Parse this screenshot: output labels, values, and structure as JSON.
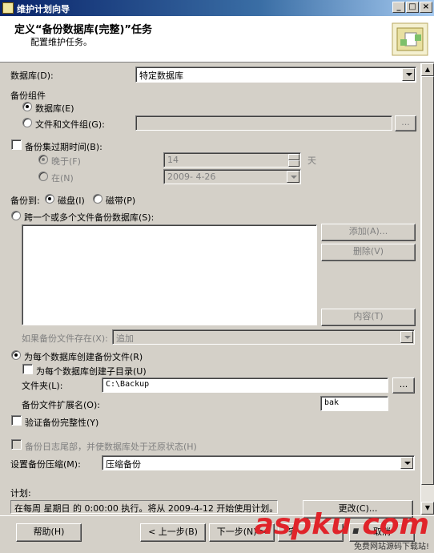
{
  "window": {
    "title": "维护计划向导",
    "controls": [
      "_",
      "□",
      "×"
    ]
  },
  "header": {
    "title": "定义“备份数据库(完整)”任务",
    "subtitle": "配置维护任务。"
  },
  "form": {
    "database_label": "数据库(D):",
    "database_value": "特定数据库",
    "backup_component_label": "备份组件",
    "radio_database": "数据库(E)",
    "radio_files": "文件和文件组(G):",
    "browse_label": "...",
    "expire_check_label": "备份集过期时间(B):",
    "after_label": "晚于(F)",
    "after_value": "14",
    "days_unit": "天",
    "on_label": "在(N)",
    "on_value": "2009- 4-26",
    "backup_to_label": "备份到:",
    "disk_label": "磁盘(I)",
    "tape_label": "磁带(P)",
    "span_files_label": "跨一个或多个文件备份数据库(S):",
    "add_button": "添加(A)...",
    "remove_button": "删除(V)",
    "contents_button": "内容(T)",
    "if_exists_label": "如果备份文件存在(X):",
    "if_exists_value": "追加",
    "per_db_file_label": "为每个数据库创建备份文件(R)",
    "per_db_subdir_label": "为每个数据库创建子目录(U)",
    "folder_label": "文件夹(L):",
    "folder_value": "C:\\Backup",
    "ext_label": "备份文件扩展名(O):",
    "ext_value": "bak",
    "verify_label": "验证备份完整性(Y)",
    "taillog_label": "备份日志尾部，并使数据库处于还原状态(H)",
    "compression_label": "设置备份压缩(M):",
    "compression_value": "压缩备份",
    "schedule_label": "计划:",
    "schedule_text": "在每周 星期日 的 0:00:00 执行。将从 2009-4-12 开始使用计划。",
    "change_button": "更改(C)..."
  },
  "footer": {
    "help": "帮助(H)",
    "back": "< 上一步(B)",
    "next": "下一步(N) >",
    "finish": "完",
    "cancel": "取消"
  },
  "watermark": {
    "logo_text": "aspku",
    "logo_dot": ".",
    "logo_tld": "com",
    "subtitle": "免费网站源码下载站!"
  },
  "colors": {
    "dialog_bg": "#d4d0c8",
    "titlebar_start": "#0a246a",
    "watermark_red": "#e0242a"
  }
}
